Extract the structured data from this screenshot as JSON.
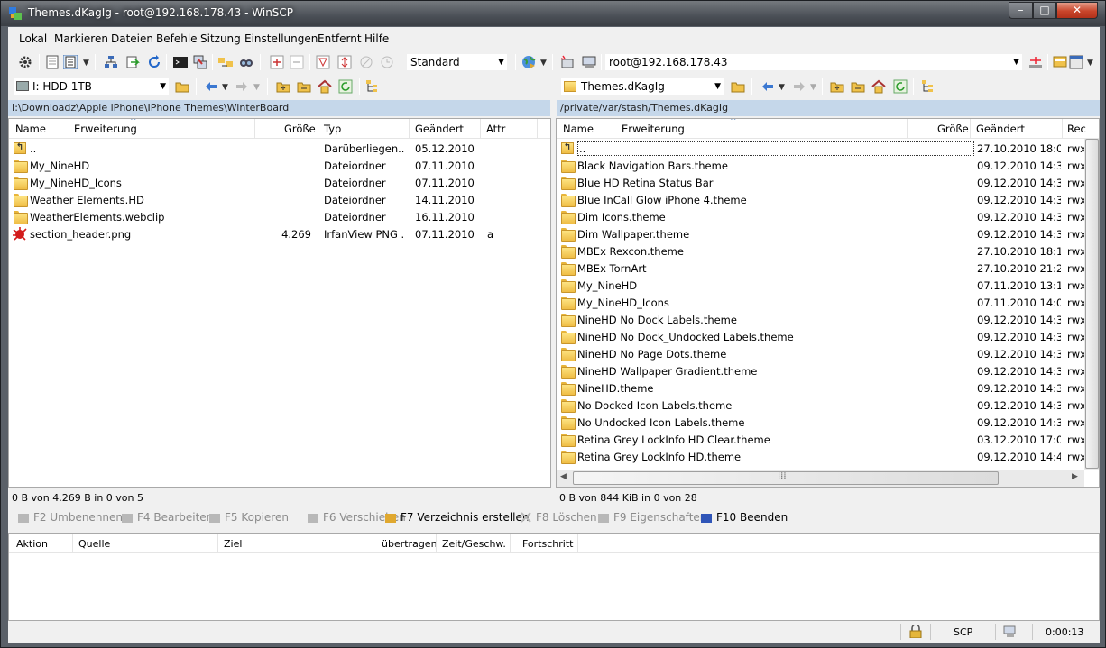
{
  "window": {
    "title": "Themes.dKagIg - root@192.168.178.43 - WinSCP",
    "min": "–",
    "max": "□",
    "close": "✕"
  },
  "menu": [
    "Lokal",
    "Markieren",
    "Dateien",
    "Befehle",
    "Sitzung",
    "Einstellungen",
    "Entfernt",
    "Hilfe"
  ],
  "toolbar": {
    "transfer_preset": "Standard",
    "session": "root@192.168.178.43"
  },
  "left": {
    "drive": "I: HDD 1TB",
    "path": "I:\\Downloadz\\Apple iPhone\\IPhone Themes\\WinterBoard",
    "columns": [
      "Name",
      "Erweiterung",
      "Größe",
      "Typ",
      "Geändert",
      "Attr"
    ],
    "rows": [
      {
        "name": "..",
        "ext": "",
        "size": "",
        "type": "Darüberliegen...",
        "date": "05.12.2010 ...",
        "attr": "",
        "icon": "updir"
      },
      {
        "name": "My_NineHD",
        "ext": "",
        "size": "",
        "type": "Dateiordner",
        "date": "07.11.2010 ...",
        "attr": "",
        "icon": "folder"
      },
      {
        "name": "My_NineHD_Icons",
        "ext": "",
        "size": "",
        "type": "Dateiordner",
        "date": "07.11.2010 ...",
        "attr": "",
        "icon": "folder"
      },
      {
        "name": "Weather Elements.HD",
        "ext": "",
        "size": "",
        "type": "Dateiordner",
        "date": "14.11.2010 ...",
        "attr": "",
        "icon": "folder"
      },
      {
        "name": "WeatherElements.webclip",
        "ext": "",
        "size": "",
        "type": "Dateiordner",
        "date": "16.11.2010 ...",
        "attr": "",
        "icon": "folder"
      },
      {
        "name": "section_header.png",
        "ext": "",
        "size": "4.269",
        "type": "IrfanView PNG ...",
        "date": "07.11.2010 ...",
        "attr": "a",
        "icon": "png"
      }
    ],
    "status": "0 B von 4.269 B in 0 von 5"
  },
  "right": {
    "dir": "Themes.dKagIg",
    "path": "/private/var/stash/Themes.dKagIg",
    "columns": [
      "Name",
      "Erweiterung",
      "Größe",
      "Geändert",
      "Rec"
    ],
    "rows": [
      {
        "name": "..",
        "date": "27.10.2010 18:0...",
        "rights": "rwx",
        "icon": "updir"
      },
      {
        "name": "Black Navigation Bars.theme",
        "date": "09.12.2010 14:3...",
        "rights": "rwx",
        "icon": "folder"
      },
      {
        "name": "Blue HD Retina Status Bar",
        "date": "09.12.2010 14:3...",
        "rights": "rwx",
        "icon": "folder"
      },
      {
        "name": "Blue InCall Glow iPhone 4.theme",
        "date": "09.12.2010 14:3...",
        "rights": "rwx",
        "icon": "folder"
      },
      {
        "name": "Dim Icons.theme",
        "date": "09.12.2010 14:3...",
        "rights": "rwx",
        "icon": "folder"
      },
      {
        "name": "Dim Wallpaper.theme",
        "date": "09.12.2010 14:3...",
        "rights": "rwx",
        "icon": "folder"
      },
      {
        "name": "MBEx Rexcon.theme",
        "date": "27.10.2010 18:1...",
        "rights": "rwx",
        "icon": "folder"
      },
      {
        "name": "MBEx TornArt",
        "date": "27.10.2010 21:2...",
        "rights": "rwx",
        "icon": "folder"
      },
      {
        "name": "My_NineHD",
        "date": "07.11.2010 13:1...",
        "rights": "rwx",
        "icon": "folder"
      },
      {
        "name": "My_NineHD_Icons",
        "date": "07.11.2010 14:0...",
        "rights": "rwx",
        "icon": "folder"
      },
      {
        "name": "NineHD No Dock Labels.theme",
        "date": "09.12.2010 14:3...",
        "rights": "rwx",
        "icon": "folder"
      },
      {
        "name": "NineHD No Dock_Undocked Labels.theme",
        "date": "09.12.2010 14:3...",
        "rights": "rwx",
        "icon": "folder"
      },
      {
        "name": "NineHD No Page Dots.theme",
        "date": "09.12.2010 14:3...",
        "rights": "rwx",
        "icon": "folder"
      },
      {
        "name": "NineHD Wallpaper Gradient.theme",
        "date": "09.12.2010 14:3...",
        "rights": "rwx",
        "icon": "folder"
      },
      {
        "name": "NineHD.theme",
        "date": "09.12.2010 14:3...",
        "rights": "rwx",
        "icon": "folder"
      },
      {
        "name": "No Docked Icon Labels.theme",
        "date": "09.12.2010 14:3...",
        "rights": "rwx",
        "icon": "folder"
      },
      {
        "name": "No Undocked Icon Labels.theme",
        "date": "09.12.2010 14:3...",
        "rights": "rwx",
        "icon": "folder"
      },
      {
        "name": "Retina Grey LockInfo HD Clear.theme",
        "date": "03.12.2010 17:0...",
        "rights": "rwx",
        "icon": "folder"
      },
      {
        "name": "Retina Grey LockInfo HD.theme",
        "date": "09.12.2010 14:4...",
        "rights": "rwx",
        "icon": "folder"
      }
    ],
    "status": "0 B von 844 KiB in 0 von 28"
  },
  "fkeys": [
    {
      "label": "F2 Umbenennen",
      "enabled": false,
      "icon": "pencil-icon"
    },
    {
      "label": "F4 Bearbeiten",
      "enabled": false,
      "icon": "edit-icon"
    },
    {
      "label": "F5 Kopieren",
      "enabled": false,
      "icon": "copy-icon"
    },
    {
      "label": "F6 Verschieben",
      "enabled": false,
      "icon": "move-icon"
    },
    {
      "label": "F7 Verzeichnis erstellen",
      "enabled": true,
      "icon": "new-folder-icon"
    },
    {
      "label": "F8 Löschen",
      "enabled": false,
      "icon": "delete-icon"
    },
    {
      "label": "F9 Eigenschaften",
      "enabled": false,
      "icon": "properties-icon"
    },
    {
      "label": "F10 Beenden",
      "enabled": true,
      "icon": "quit-icon"
    }
  ],
  "queue": {
    "columns": [
      "Aktion",
      "Quelle",
      "Ziel",
      "übertragen",
      "Zeit/Geschw.",
      "Fortschritt"
    ]
  },
  "statusbar": {
    "protocol": "SCP",
    "time": "0:00:13"
  },
  "colors": {
    "path_bar": "#c5d7ea",
    "folder": "#f0c24b",
    "close_button": "#c9452b"
  }
}
